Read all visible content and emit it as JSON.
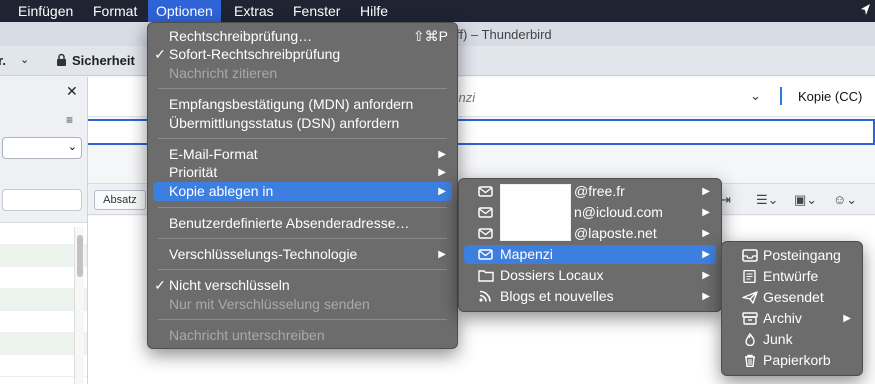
{
  "menubar": {
    "items": [
      "Einfügen",
      "Format",
      "Optionen",
      "Extras",
      "Fenster",
      "Hilfe"
    ],
    "active": "Optionen",
    "location_icon": "location-arrow-icon"
  },
  "window": {
    "title_fragment": "ff) – Thunderbird"
  },
  "toolbar": {
    "cut_label": "r.",
    "security_label": "Sicherheit"
  },
  "compose": {
    "from_partial": "penzi",
    "cc_label": "Kopie (CC)",
    "paragraph_format": "Absatz"
  },
  "options_menu": {
    "items": [
      {
        "label": "Rechtschreibprüfung…",
        "shortcut": "⇧⌘P"
      },
      {
        "label": "Sofort-Rechtschreibprüfung",
        "checked": true
      },
      {
        "label": "Nachricht zitieren",
        "disabled": true
      },
      {
        "label": "Empfangsbestätigung (MDN) anfordern"
      },
      {
        "label": "Übermittlungsstatus (DSN) anfordern"
      },
      {
        "label": "E-Mail-Format",
        "submenu": true
      },
      {
        "label": "Priorität",
        "submenu": true
      },
      {
        "label": "Kopie ablegen in",
        "submenu": true,
        "highlighted": true
      },
      {
        "label": "Benutzerdefinierte Absenderadresse…"
      },
      {
        "label": "Verschlüsselungs-Technologie",
        "submenu": true
      },
      {
        "label": "Nicht verschlüsseln",
        "checked": true
      },
      {
        "label": "Nur mit Verschlüsselung senden",
        "disabled": true
      },
      {
        "label": "Nachricht unterschreiben",
        "disabled": true
      }
    ]
  },
  "copy_menu": {
    "items": [
      {
        "label": "@free.fr",
        "icon": "mail-account-icon"
      },
      {
        "label": "n@icloud.com",
        "icon": "mail-account-icon"
      },
      {
        "label": "@laposte.net",
        "icon": "mail-account-icon"
      },
      {
        "label": "Mapenzi",
        "icon": "mail-account-icon",
        "highlighted": true
      },
      {
        "label": "Dossiers Locaux",
        "icon": "folder-icon"
      },
      {
        "label": "Blogs et nouvelles",
        "icon": "rss-icon"
      }
    ]
  },
  "folder_menu": {
    "items": [
      {
        "label": "Posteingang",
        "icon": "inbox-icon"
      },
      {
        "label": "Entwürfe",
        "icon": "drafts-icon"
      },
      {
        "label": "Gesendet",
        "icon": "send-icon"
      },
      {
        "label": "Archiv",
        "icon": "archive-icon",
        "submenu": true
      },
      {
        "label": "Junk",
        "icon": "junk-icon"
      },
      {
        "label": "Papierkorb",
        "icon": "trash-icon"
      }
    ]
  }
}
